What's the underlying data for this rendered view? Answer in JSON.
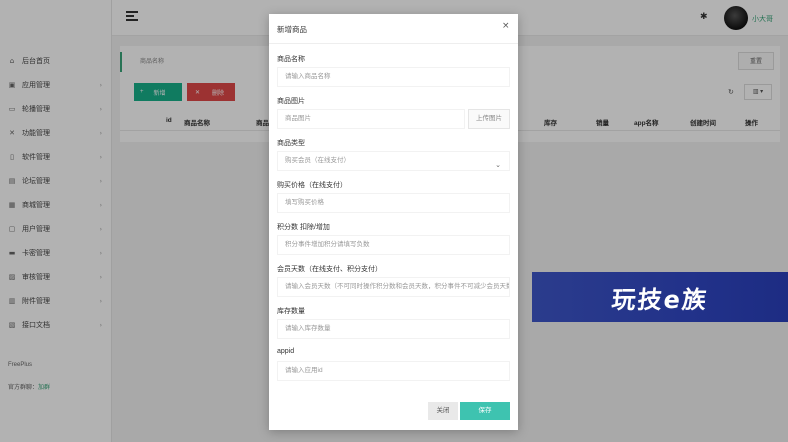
{
  "sidebar": {
    "items": [
      {
        "icon": "home-icon",
        "glyph": "⌂",
        "label": "后台首页",
        "has_arrow": false
      },
      {
        "icon": "app-icon",
        "glyph": "▣",
        "label": "应用管理",
        "has_arrow": true
      },
      {
        "icon": "chat-icon",
        "glyph": "▭",
        "label": "轮播管理",
        "has_arrow": true
      },
      {
        "icon": "tool-icon",
        "glyph": "✕",
        "label": "功能管理",
        "has_arrow": true
      },
      {
        "icon": "bookmark-icon",
        "glyph": "▯",
        "label": "软件管理",
        "has_arrow": true
      },
      {
        "icon": "forum-icon",
        "glyph": "▤",
        "label": "论坛管理",
        "has_arrow": true
      },
      {
        "icon": "shop-icon",
        "glyph": "▦",
        "label": "商城管理",
        "has_arrow": true
      },
      {
        "icon": "user-icon",
        "glyph": "▢",
        "label": "用户管理",
        "has_arrow": true
      },
      {
        "icon": "card-icon",
        "glyph": "▬",
        "label": "卡密管理",
        "has_arrow": true
      },
      {
        "icon": "audit-icon",
        "glyph": "▨",
        "label": "审核管理",
        "has_arrow": true
      },
      {
        "icon": "extra-icon",
        "glyph": "▥",
        "label": "附件管理",
        "has_arrow": true
      },
      {
        "icon": "doc-icon",
        "glyph": "▧",
        "label": "接口文档",
        "has_arrow": true
      }
    ],
    "footer_brand": "FreePlus",
    "footer_group_label": "官方群聊：",
    "footer_group_link": "加群"
  },
  "topbar": {
    "username": "小大哥"
  },
  "toolbar": {
    "search_tab": "商品名称",
    "reset_label": "重置",
    "add_label": "新增",
    "delete_label": "删除",
    "cols_label": "▥ ▾"
  },
  "table": {
    "headers": [
      "id",
      "商品名称",
      "商品",
      "库存",
      "销量",
      "app名称",
      "创建时间",
      "操作"
    ]
  },
  "modal": {
    "title": "新增商品",
    "fields": {
      "name_label": "商品名称",
      "name_placeholder": "请输入商品名称",
      "image_label": "商品图片",
      "image_placeholder": "商品图片",
      "upload_label": "上传图片",
      "type_label": "商品类型",
      "type_value": "购买会员（在线支付）",
      "price_label": "购买价格（在线支付）",
      "price_placeholder": "填写购买价格",
      "points_label": "积分数 扣除/增加",
      "points_placeholder": "积分事件增加积分请填写负数",
      "days_label": "会员天数（在线支付、积分支付）",
      "days_placeholder": "请输入会员天数（不可同时操作积分数和会员天数，积分事件不可减少会员天数）",
      "stock_label": "库存数量",
      "stock_placeholder": "请输入库存数量",
      "appid_label": "appid",
      "appid_placeholder": "请输入应用id"
    },
    "cancel_label": "关闭",
    "save_label": "保存"
  },
  "watermark": {
    "text": "玩技e族"
  },
  "colors": {
    "accent": "#3ec3b0",
    "add_button": "#17b08a",
    "delete_button": "#e04848",
    "link_green": "#3aa57a",
    "watermark_bg": "#22328a"
  }
}
